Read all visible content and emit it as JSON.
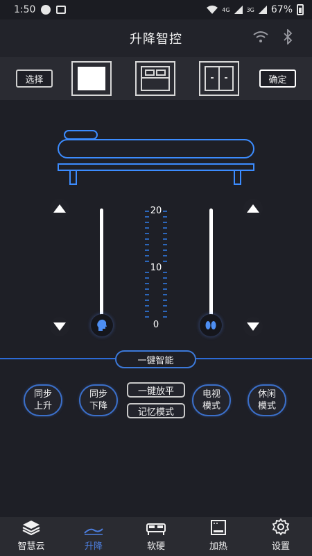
{
  "status_bar": {
    "time": "1:50",
    "net1": "4G",
    "net2": "3G",
    "battery": "67%"
  },
  "header": {
    "title": "升降智控"
  },
  "toolbar": {
    "select_label": "选择",
    "confirm_label": "确定"
  },
  "scale": {
    "top": "20",
    "mid": "10",
    "bottom": "0"
  },
  "one_key": {
    "title": "一键智能"
  },
  "modes": {
    "sync_up": [
      "同步",
      "上升"
    ],
    "sync_down": [
      "同步",
      "下降"
    ],
    "flat": "一键放平",
    "memory": "记忆模式",
    "tv": [
      "电视",
      "模式"
    ],
    "leisure": [
      "休闲",
      "模式"
    ]
  },
  "nav": {
    "items": [
      {
        "label": "智慧云",
        "icon": "layers-icon"
      },
      {
        "label": "升降",
        "icon": "lift-bed-icon"
      },
      {
        "label": "软硬",
        "icon": "bed-icon"
      },
      {
        "label": "加热",
        "icon": "heater-icon"
      },
      {
        "label": "设置",
        "icon": "gear-icon"
      }
    ],
    "active": "升降"
  },
  "colors": {
    "accent": "#3c79d9",
    "background": "#1e1f26",
    "active_nav": "#4d7fe0"
  }
}
